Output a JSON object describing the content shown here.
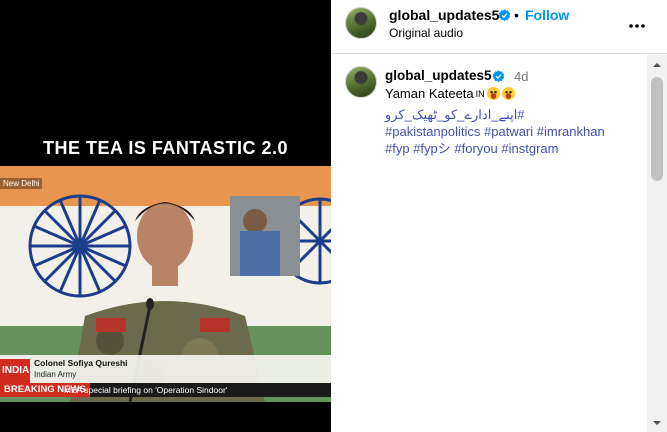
{
  "video": {
    "caption": "THE TEA IS FANTASTIC 2.0",
    "location_tag": "New Delhi",
    "lower_third": {
      "section": "INDIA",
      "name": "Colonel Sofiya Qureshi",
      "role": "Indian Army",
      "breaking_label": "BREAKING NEWS",
      "headline": "MEA special briefing on 'Operation Sindoor'"
    }
  },
  "post_header": {
    "username": "global_updates5",
    "separator": "•",
    "follow_label": "Follow",
    "audio": "Original audio"
  },
  "comment": {
    "username": "global_updates5",
    "age": "4d",
    "text": "Yaman Kateeta",
    "lang_badge": "IN",
    "hashtags": [
      "#اپنے_ادارے_کو_ٹھیک_کرو",
      "#pakistanpolitics",
      "#patwari",
      "#imrankhan",
      "#fyp",
      "#fypシ",
      "#foryou",
      "#instgram"
    ]
  },
  "icons": {
    "verified": "verified-badge-icon",
    "more": "more-options-icon",
    "scroll_up": "scroll-up-arrow-icon",
    "scroll_down": "scroll-down-arrow-icon"
  },
  "colors": {
    "follow": "#0095f6",
    "hashtag": "#3f51b5",
    "verified": "#0095f6",
    "breaking": "#d12b1f"
  }
}
